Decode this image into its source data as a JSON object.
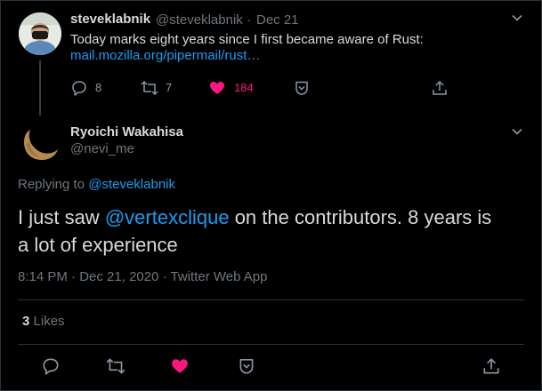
{
  "parent_tweet": {
    "author_name": "steveklabnik",
    "handle": "@steveklabnik",
    "sep": "·",
    "date": "Dec 21",
    "text": "Today marks eight years since I first became aware of Rust:",
    "link": "mail.mozilla.org/pipermail/rust…",
    "replies": "8",
    "retweets": "7",
    "likes": "184"
  },
  "main_tweet": {
    "author_name": "Ryoichi Wakahisa",
    "handle": "@nevi_me",
    "replying_prefix": "Replying to",
    "replying_to": "@steveklabnik",
    "text_before": "I just saw",
    "mention": "@vertexclique",
    "text_after": "on the contributors. 8 years is",
    "text_line2": "a lot of experience",
    "time": "8:14 PM",
    "sep": "·",
    "date": "Dec 21, 2020",
    "source": "Twitter Web App",
    "like_count": "3",
    "like_label": "Likes"
  },
  "colors": {
    "background": "#000000",
    "link": "#1d9bf0",
    "like": "#f91880",
    "muted": "#6e767d",
    "border": "#2f3336"
  },
  "icons": [
    "chevron-down-icon",
    "reply-icon",
    "retweet-icon",
    "heart-icon",
    "bookmark-icon",
    "share-icon"
  ]
}
